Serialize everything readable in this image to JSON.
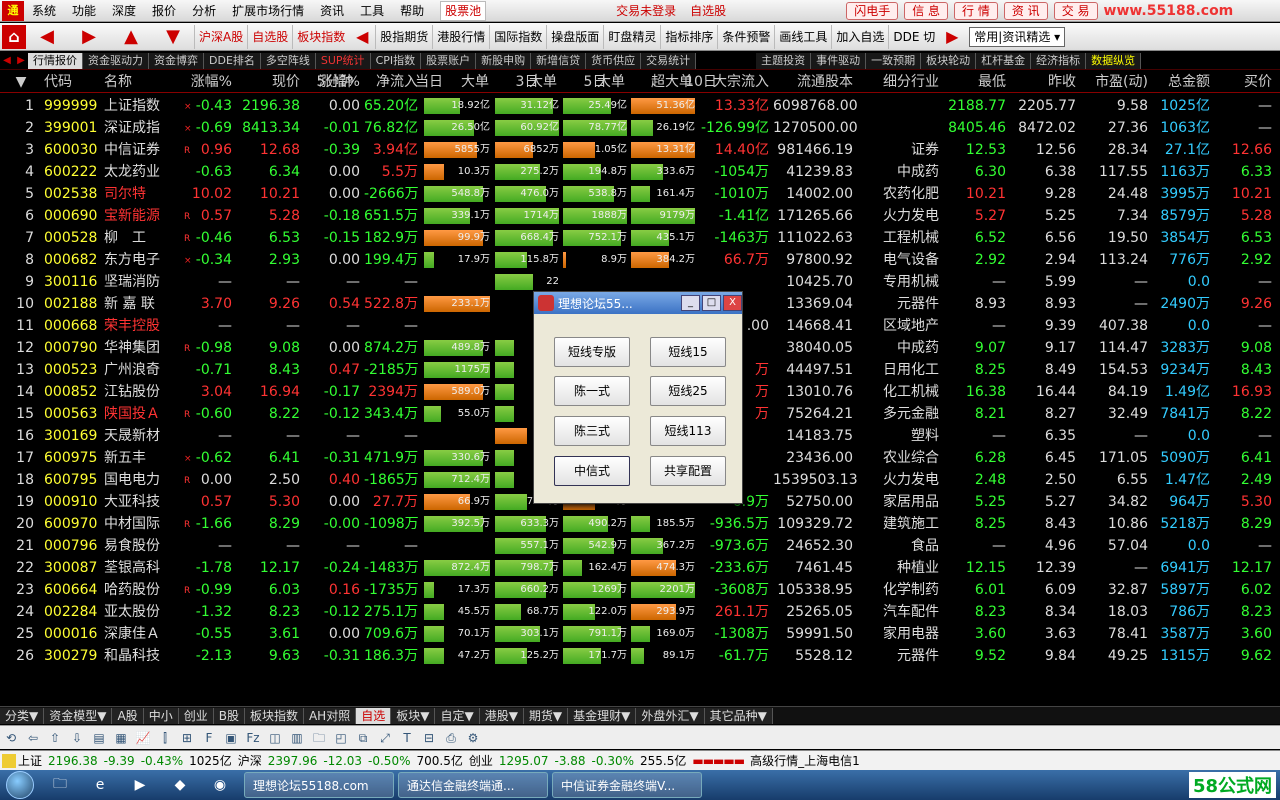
{
  "menubar": {
    "items": [
      "系统",
      "功能",
      "深度",
      "报价",
      "分析",
      "扩展市场行情",
      "资讯",
      "工具",
      "帮助"
    ],
    "stock_pool": "股票池",
    "login": "交易未登录",
    "favorite": "自选股",
    "right_buttons": [
      "闪电手",
      "信 息",
      "行 情",
      "资 讯",
      "交 易"
    ],
    "watermark": "www.55188.com"
  },
  "toolbar": {
    "buttons": [
      "沪深A股",
      "自选股",
      "板块指数",
      "股指期货",
      "港股行情",
      "国际指数",
      "操盘版面",
      "盯盘精灵",
      "指标排序",
      "条件预警",
      "画线工具",
      "加入自选",
      "DDE 切"
    ],
    "select_value": "常用|资讯精选"
  },
  "tabs": [
    "行情报价",
    "资金驱动力",
    "资金博弈",
    "DDE排名",
    "多空阵线",
    "SUP统计",
    "CPI指数",
    "股票账户",
    "新股申购",
    "新增信贷",
    "货币供应",
    "交易统计",
    "主题投资",
    "事件驱动",
    "一致预期",
    "板块轮动",
    "杠杆基金",
    "经济指标",
    "数据纵览"
  ],
  "header": {
    "groups": {
      "g5": "5分钟",
      "gd": "当日",
      "g3": "3日",
      "g5d": "5日",
      "g10": "10日"
    },
    "cols": [
      "代码",
      "名称",
      "涨幅%",
      "现价",
      "涨幅%",
      "净流入",
      "大单",
      "大单",
      "大单",
      "超大单",
      "大宗流入",
      "流通股本",
      "细分行业",
      "最低",
      "昨收",
      "市盈(动)",
      "总金额",
      "买价"
    ]
  },
  "rows": [
    {
      "n": "1",
      "code": "999999",
      "name": "上证指数",
      "nc": "W",
      "mark": "×",
      "chg": "-0.43",
      "chgc": "G",
      "price": "2196.38",
      "pc": "G",
      "m5": "0.00",
      "m5c": "W",
      "inflow": "65.20亿",
      "ic": "G",
      "d": "18.92亿",
      "dv": -0.55,
      "d3": "31.12亿",
      "d3v": -0.9,
      "d5": "25.49亿",
      "d5v": -0.75,
      "d10": "51.36亿",
      "d10v": 1.0,
      "bulk": "13.33亿",
      "bc": "R",
      "float": "6098768.00",
      "ind": "",
      "low": "2188.77",
      "lc": "G",
      "prev": "2205.77",
      "pe": "9.58",
      "amt": "1025亿",
      "bid": "—",
      "bidc": "W"
    },
    {
      "n": "2",
      "code": "399001",
      "name": "深证成指",
      "nc": "W",
      "mark": "×",
      "chg": "-0.69",
      "chgc": "G",
      "price": "8413.34",
      "pc": "G",
      "m5": "-0.01",
      "m5c": "G",
      "inflow": "76.82亿",
      "ic": "G",
      "d": "26.50亿",
      "dv": -0.75,
      "d3": "60.92亿",
      "d3v": -1.0,
      "d5": "78.77亿",
      "d5v": -1.0,
      "d10": "26.19亿",
      "d10v": -0.35,
      "bulk": "-126.99亿",
      "bc": "G",
      "float": "1270500.00",
      "ind": "",
      "low": "8405.46",
      "lc": "G",
      "prev": "8472.02",
      "pe": "27.36",
      "amt": "1063亿",
      "bid": "—",
      "bidc": "W"
    },
    {
      "n": "3",
      "code": "600030",
      "name": "中信证券",
      "nc": "W",
      "mark": "R",
      "chg": "0.96",
      "chgc": "R",
      "price": "12.68",
      "pc": "R",
      "m5": "-0.39",
      "m5c": "G",
      "inflow": "3.94亿",
      "ic": "R",
      "d": "5855万",
      "dv": 0.8,
      "d3": "6852万",
      "d3v": 0.6,
      "d5": "1.05亿",
      "d5v": 0.5,
      "d10": "13.31亿",
      "d10v": 1.0,
      "bulk": "14.40亿",
      "bc": "R",
      "float": "981466.19",
      "ind": "证券",
      "low": "12.53",
      "lc": "G",
      "prev": "12.56",
      "pe": "28.34",
      "amt": "27.1亿",
      "bid": "12.66",
      "bidc": "R"
    },
    {
      "n": "4",
      "code": "600222",
      "name": "太龙药业",
      "nc": "W",
      "mark": "",
      "chg": "-0.63",
      "chgc": "G",
      "price": "6.34",
      "pc": "G",
      "m5": "0.00",
      "m5c": "W",
      "inflow": "5.5万",
      "ic": "R",
      "d": "10.3万",
      "dv": 0.3,
      "d3": "275.2万",
      "d3v": -0.7,
      "d5": "194.8万",
      "d5v": -0.6,
      "d10": "333.6万",
      "d10v": -0.5,
      "bulk": "-1054万",
      "bc": "G",
      "float": "41239.83",
      "ind": "中成药",
      "low": "6.30",
      "lc": "G",
      "prev": "6.38",
      "pe": "117.55",
      "amt": "1163万",
      "bid": "6.33",
      "bidc": "G"
    },
    {
      "n": "5",
      "code": "002538",
      "name": "司尔特",
      "nc": "R",
      "mark": "",
      "chg": "10.02",
      "chgc": "R",
      "price": "10.21",
      "pc": "R",
      "m5": "0.00",
      "m5c": "W",
      "inflow": "-2666万",
      "ic": "G",
      "d": "548.8万",
      "dv": -0.9,
      "d3": "476.0万",
      "d3v": -0.8,
      "d5": "538.8万",
      "d5v": -0.8,
      "d10": "161.4万",
      "d10v": -0.3,
      "bulk": "-1010万",
      "bc": "G",
      "float": "14002.00",
      "ind": "农药化肥",
      "low": "10.21",
      "lc": "R",
      "prev": "9.28",
      "pe": "24.48",
      "amt": "3995万",
      "bid": "10.21",
      "bidc": "R"
    },
    {
      "n": "6",
      "code": "000690",
      "name": "宝新能源",
      "nc": "R",
      "mark": "R",
      "chg": "0.57",
      "chgc": "R",
      "price": "5.28",
      "pc": "R",
      "m5": "-0.18",
      "m5c": "G",
      "inflow": "651.5万",
      "ic": "G",
      "d": "339.1万",
      "dv": -0.7,
      "d3": "1714万",
      "d3v": -1.0,
      "d5": "1888万",
      "d5v": -1.0,
      "d10": "9179万",
      "d10v": -1.0,
      "bulk": "-1.41亿",
      "bc": "G",
      "float": "171265.66",
      "ind": "火力发电",
      "low": "5.27",
      "lc": "R",
      "prev": "5.25",
      "pe": "7.34",
      "amt": "8579万",
      "bid": "5.28",
      "bidc": "R"
    },
    {
      "n": "7",
      "code": "000528",
      "name": "柳　工",
      "nc": "W",
      "mark": "R",
      "chg": "-0.46",
      "chgc": "G",
      "price": "6.53",
      "pc": "G",
      "m5": "-0.15",
      "m5c": "G",
      "inflow": "182.9万",
      "ic": "G",
      "d": "99.9万",
      "dv": 0.9,
      "d3": "668.4万",
      "d3v": -0.9,
      "d5": "752.1万",
      "d5v": -0.9,
      "d10": "435.1万",
      "d10v": -0.6,
      "bulk": "-1463万",
      "bc": "G",
      "float": "111022.63",
      "ind": "工程机械",
      "low": "6.52",
      "lc": "G",
      "prev": "6.56",
      "pe": "19.50",
      "amt": "3854万",
      "bid": "6.53",
      "bidc": "G"
    },
    {
      "n": "8",
      "code": "000682",
      "name": "东方电子",
      "nc": "W",
      "mark": "×",
      "chg": "-0.34",
      "chgc": "G",
      "price": "2.93",
      "pc": "G",
      "m5": "0.00",
      "m5c": "W",
      "inflow": "199.4万",
      "ic": "G",
      "d": "17.9万",
      "dv": -0.15,
      "d3": "115.8万",
      "d3v": -0.5,
      "d5": "8.9万",
      "d5v": 0.05,
      "d10": "384.2万",
      "d10v": 0.6,
      "bulk": "66.7万",
      "bc": "R",
      "float": "97800.92",
      "ind": "电气设备",
      "low": "2.92",
      "lc": "G",
      "prev": "2.94",
      "pe": "113.24",
      "amt": "776万",
      "bid": "2.92",
      "bidc": "G"
    },
    {
      "n": "9",
      "code": "300116",
      "name": "坚瑞消防",
      "nc": "W",
      "mark": "",
      "chg": "—",
      "chgc": "W",
      "price": "—",
      "pc": "W",
      "m5": "—",
      "m5c": "W",
      "inflow": "—",
      "ic": "W",
      "d": "",
      "dv": 0,
      "d3": "22",
      "d3v": -0.6,
      "d5": "",
      "d5v": 0,
      "d10": "",
      "d10v": 0,
      "bulk": "",
      "bc": "W",
      "float": "10425.70",
      "ind": "专用机械",
      "low": "—",
      "lc": "W",
      "prev": "5.99",
      "pe": "—",
      "amt": "0.0",
      "bid": "—",
      "bidc": "W"
    },
    {
      "n": "10",
      "code": "002188",
      "name": "新 嘉 联",
      "nc": "W",
      "mark": "",
      "chg": "3.70",
      "chgc": "R",
      "price": "9.26",
      "pc": "R",
      "m5": "0.54",
      "m5c": "R",
      "inflow": "522.8万",
      "ic": "R",
      "d": "233.1万",
      "dv": 1.0,
      "d3": "",
      "d3v": 0,
      "d5": "",
      "d5v": 0,
      "d10": "",
      "d10v": 0,
      "bulk": "",
      "bc": "W",
      "float": "13369.04",
      "ind": "元器件",
      "low": "8.93",
      "lc": "W",
      "prev": "8.93",
      "pe": "—",
      "amt": "2490万",
      "bid": "9.26",
      "bidc": "R"
    },
    {
      "n": "11",
      "code": "000668",
      "name": "荣丰控股",
      "nc": "R",
      "mark": "",
      "chg": "—",
      "chgc": "W",
      "price": "—",
      "pc": "W",
      "m5": "—",
      "m5c": "W",
      "inflow": "—",
      "ic": "W",
      "d": "",
      "dv": 0,
      "d3": "",
      "d3v": 0,
      "d5": "",
      "d5v": 0,
      "d10": "",
      "d10v": 0,
      "bulk": ".00",
      "bc": "W",
      "float": "14668.41",
      "ind": "区域地产",
      "low": "—",
      "lc": "W",
      "prev": "9.39",
      "pe": "407.38",
      "amt": "0.0",
      "bid": "—",
      "bidc": "W"
    },
    {
      "n": "12",
      "code": "000790",
      "name": "华神集团",
      "nc": "W",
      "mark": "R",
      "chg": "-0.98",
      "chgc": "G",
      "price": "9.08",
      "pc": "G",
      "m5": "0.00",
      "m5c": "W",
      "inflow": "874.2万",
      "ic": "G",
      "d": "489.8万",
      "dv": -0.9,
      "d3": "1",
      "d3v": -0.3,
      "d5": "",
      "d5v": 0,
      "d10": "",
      "d10v": 0,
      "bulk": "",
      "bc": "W",
      "float": "38040.05",
      "ind": "中成药",
      "low": "9.07",
      "lc": "G",
      "prev": "9.17",
      "pe": "114.47",
      "amt": "3283万",
      "bid": "9.08",
      "bidc": "G"
    },
    {
      "n": "13",
      "code": "000523",
      "name": "广州浪奇",
      "nc": "W",
      "mark": "",
      "chg": "-0.71",
      "chgc": "G",
      "price": "8.43",
      "pc": "G",
      "m5": "0.47",
      "m5c": "R",
      "inflow": "-2185万",
      "ic": "G",
      "d": "1175万",
      "dv": -1.0,
      "d3": "",
      "d3v": -0.3,
      "d5": "",
      "d5v": 0,
      "d10": "",
      "d10v": 0,
      "bulk": "万",
      "bc": "R",
      "float": "44497.51",
      "ind": "日用化工",
      "low": "8.25",
      "lc": "G",
      "prev": "8.49",
      "pe": "154.53",
      "amt": "9234万",
      "bid": "8.43",
      "bidc": "G"
    },
    {
      "n": "14",
      "code": "000852",
      "name": "江钻股份",
      "nc": "W",
      "mark": "",
      "chg": "3.04",
      "chgc": "R",
      "price": "16.94",
      "pc": "R",
      "m5": "-0.17",
      "m5c": "G",
      "inflow": "2394万",
      "ic": "R",
      "d": "589.0万",
      "dv": 0.9,
      "d3": "",
      "d3v": -0.3,
      "d5": "",
      "d5v": 0,
      "d10": "",
      "d10v": 0,
      "bulk": "万",
      "bc": "R",
      "float": "13010.76",
      "ind": "化工机械",
      "low": "16.38",
      "lc": "G",
      "prev": "16.44",
      "pe": "84.19",
      "amt": "1.49亿",
      "bid": "16.93",
      "bidc": "R"
    },
    {
      "n": "15",
      "code": "000563",
      "name": "陕国投Ａ",
      "nc": "R",
      "mark": "R",
      "chg": "-0.60",
      "chgc": "G",
      "price": "8.22",
      "pc": "G",
      "m5": "-0.12",
      "m5c": "G",
      "inflow": "343.4万",
      "ic": "G",
      "d": "55.0万",
      "dv": -0.25,
      "d3": "",
      "d3v": -0.3,
      "d5": "",
      "d5v": 0,
      "d10": "",
      "d10v": 0,
      "bulk": "万",
      "bc": "R",
      "float": "75264.21",
      "ind": "多元金融",
      "low": "8.21",
      "lc": "G",
      "prev": "8.27",
      "pe": "32.49",
      "amt": "7841万",
      "bid": "8.22",
      "bidc": "G"
    },
    {
      "n": "16",
      "code": "300169",
      "name": "天晟新材",
      "nc": "W",
      "mark": "",
      "chg": "—",
      "chgc": "W",
      "price": "—",
      "pc": "W",
      "m5": "—",
      "m5c": "W",
      "inflow": "—",
      "ic": "W",
      "d": "",
      "dv": 0,
      "d3": "12",
      "d3v": 0.5,
      "d5": "",
      "d5v": 0,
      "d10": "",
      "d10v": 0,
      "bulk": "",
      "bc": "W",
      "float": "14183.75",
      "ind": "塑料",
      "low": "—",
      "lc": "W",
      "prev": "6.35",
      "pe": "—",
      "amt": "0.0",
      "bid": "—",
      "bidc": "W"
    },
    {
      "n": "17",
      "code": "600975",
      "name": "新五丰",
      "nc": "W",
      "mark": "×",
      "chg": "-0.62",
      "chgc": "G",
      "price": "6.41",
      "pc": "G",
      "m5": "-0.31",
      "m5c": "G",
      "inflow": "471.9万",
      "ic": "G",
      "d": "330.6万",
      "dv": -0.9,
      "d3": "14",
      "d3v": -0.3,
      "d5": "",
      "d5v": 0,
      "d10": "",
      "d10v": 0,
      "bulk": "",
      "bc": "W",
      "float": "23436.00",
      "ind": "农业综合",
      "low": "6.28",
      "lc": "G",
      "prev": "6.45",
      "pe": "171.05",
      "amt": "5090万",
      "bid": "6.41",
      "bidc": "G"
    },
    {
      "n": "18",
      "code": "600795",
      "name": "国电电力",
      "nc": "W",
      "mark": "R",
      "chg": "0.00",
      "chgc": "W",
      "price": "2.50",
      "pc": "W",
      "m5": "0.40",
      "m5c": "R",
      "inflow": "-1865万",
      "ic": "G",
      "d": "712.4万",
      "dv": -1.0,
      "d3": "76",
      "d3v": -0.3,
      "d5": "",
      "d5v": 0,
      "d10": "",
      "d10v": 0,
      "bulk": "",
      "bc": "W",
      "float": "1539503.13",
      "ind": "火力发电",
      "low": "2.48",
      "lc": "G",
      "prev": "2.50",
      "pe": "6.55",
      "amt": "1.47亿",
      "bid": "2.49",
      "bidc": "G"
    },
    {
      "n": "19",
      "code": "000910",
      "name": "大亚科技",
      "nc": "W",
      "mark": "",
      "chg": "0.57",
      "chgc": "R",
      "price": "5.30",
      "pc": "R",
      "m5": "0.00",
      "m5c": "W",
      "inflow": "27.7万",
      "ic": "R",
      "d": "66.9万",
      "dv": 0.7,
      "d3": "72.5万",
      "d3v": -0.5,
      "d5": "83.4万",
      "d5v": 0.5,
      "d10": "",
      "d10v": 0,
      "bulk": "-6.9万",
      "bc": "G",
      "float": "52750.00",
      "ind": "家居用品",
      "low": "5.25",
      "lc": "G",
      "prev": "5.27",
      "pe": "34.82",
      "amt": "964万",
      "bid": "5.30",
      "bidc": "R"
    },
    {
      "n": "20",
      "code": "600970",
      "name": "中材国际",
      "nc": "W",
      "mark": "R",
      "chg": "-1.66",
      "chgc": "G",
      "price": "8.29",
      "pc": "G",
      "m5": "-0.00",
      "m5c": "G",
      "inflow": "-1098万",
      "ic": "G",
      "d": "392.5万",
      "dv": -0.9,
      "d3": "633.3万",
      "d3v": -0.8,
      "d5": "490.2万",
      "d5v": -0.7,
      "d10": "185.5万",
      "d10v": -0.3,
      "bulk": "-936.5万",
      "bc": "G",
      "float": "109329.72",
      "ind": "建筑施工",
      "low": "8.25",
      "lc": "G",
      "prev": "8.43",
      "pe": "10.86",
      "amt": "5218万",
      "bid": "8.29",
      "bidc": "G"
    },
    {
      "n": "21",
      "code": "000796",
      "name": "易食股份",
      "nc": "W",
      "mark": "",
      "chg": "—",
      "chgc": "W",
      "price": "—",
      "pc": "W",
      "m5": "—",
      "m5c": "W",
      "inflow": "—",
      "ic": "W",
      "d": "",
      "dv": 0,
      "d3": "557.1万",
      "d3v": -0.8,
      "d5": "542.9万",
      "d5v": -0.8,
      "d10": "367.2万",
      "d10v": -0.5,
      "bulk": "-973.6万",
      "bc": "G",
      "float": "24652.30",
      "ind": "食品",
      "low": "—",
      "lc": "W",
      "prev": "4.96",
      "pe": "57.04",
      "amt": "0.0",
      "bid": "—",
      "bidc": "W"
    },
    {
      "n": "22",
      "code": "300087",
      "name": "荃银高科",
      "nc": "W",
      "mark": "",
      "chg": "-1.78",
      "chgc": "G",
      "price": "12.17",
      "pc": "G",
      "m5": "-0.24",
      "m5c": "G",
      "inflow": "-1483万",
      "ic": "G",
      "d": "872.4万",
      "dv": -1.0,
      "d3": "798.7万",
      "d3v": -0.9,
      "d5": "162.4万",
      "d5v": -0.3,
      "d10": "474.3万",
      "d10v": 0.7,
      "bulk": "-233.6万",
      "bc": "G",
      "float": "7461.45",
      "ind": "种植业",
      "low": "12.15",
      "lc": "G",
      "prev": "12.39",
      "pe": "—",
      "amt": "6941万",
      "bid": "12.17",
      "bidc": "G"
    },
    {
      "n": "23",
      "code": "600664",
      "name": "哈药股份",
      "nc": "W",
      "mark": "R",
      "chg": "-0.99",
      "chgc": "G",
      "price": "6.03",
      "pc": "G",
      "m5": "0.16",
      "m5c": "R",
      "inflow": "-1735万",
      "ic": "G",
      "d": "17.3万",
      "dv": -0.15,
      "d3": "660.2万",
      "d3v": -0.8,
      "d5": "1269万",
      "d5v": -0.9,
      "d10": "2201万",
      "d10v": -1.0,
      "bulk": "-3608万",
      "bc": "G",
      "float": "105338.95",
      "ind": "化学制药",
      "low": "6.01",
      "lc": "G",
      "prev": "6.09",
      "pe": "32.87",
      "amt": "5897万",
      "bid": "6.02",
      "bidc": "G"
    },
    {
      "n": "24",
      "code": "002284",
      "name": "亚太股份",
      "nc": "W",
      "mark": "",
      "chg": "-1.32",
      "chgc": "G",
      "price": "8.23",
      "pc": "G",
      "m5": "-0.12",
      "m5c": "G",
      "inflow": "275.1万",
      "ic": "G",
      "d": "45.5万",
      "dv": -0.3,
      "d3": "68.7万",
      "d3v": -0.4,
      "d5": "122.0万",
      "d5v": -0.5,
      "d10": "293.9万",
      "d10v": 0.7,
      "bulk": "261.1万",
      "bc": "R",
      "float": "25265.05",
      "ind": "汽车配件",
      "low": "8.23",
      "lc": "G",
      "prev": "8.34",
      "pe": "18.03",
      "amt": "786万",
      "bid": "8.23",
      "bidc": "G"
    },
    {
      "n": "25",
      "code": "000016",
      "name": "深康佳Ａ",
      "nc": "W",
      "mark": "",
      "chg": "-0.55",
      "chgc": "G",
      "price": "3.61",
      "pc": "G",
      "m5": "0.00",
      "m5c": "W",
      "inflow": "709.6万",
      "ic": "G",
      "d": "70.1万",
      "dv": -0.3,
      "d3": "303.1万",
      "d3v": -0.7,
      "d5": "791.1万",
      "d5v": -0.9,
      "d10": "169.0万",
      "d10v": -0.3,
      "bulk": "-1308万",
      "bc": "G",
      "float": "59991.50",
      "ind": "家用电器",
      "low": "3.60",
      "lc": "G",
      "prev": "3.63",
      "pe": "78.41",
      "amt": "3587万",
      "bid": "3.60",
      "bidc": "G"
    },
    {
      "n": "26",
      "code": "300279",
      "name": "和晶科技",
      "nc": "W",
      "mark": "",
      "chg": "-2.13",
      "chgc": "G",
      "price": "9.63",
      "pc": "G",
      "m5": "-0.31",
      "m5c": "G",
      "inflow": "186.3万",
      "ic": "G",
      "d": "47.2万",
      "dv": -0.3,
      "d3": "125.2万",
      "d3v": -0.5,
      "d5": "171.7万",
      "d5v": -0.6,
      "d10": "89.1万",
      "d10v": -0.2,
      "bulk": "-61.7万",
      "bc": "G",
      "float": "5528.12",
      "ind": "元器件",
      "low": "9.52",
      "lc": "G",
      "prev": "9.84",
      "pe": "49.25",
      "amt": "1315万",
      "bid": "9.62",
      "bidc": "G"
    }
  ],
  "bottom_tabs": [
    "分类▼",
    "资金模型▼",
    "A股",
    "中小",
    "创业",
    "B股",
    "板块指数",
    "AH对照",
    "自选",
    "板块▼",
    "自定▼",
    "港股▼",
    "期货▼",
    "基金理财▼",
    "外盘外汇▼",
    "其它品种▼"
  ],
  "status": {
    "sh_label": "上证",
    "sh_price": "2196.38",
    "sh_chg": "-9.39",
    "sh_pct": "-0.43%",
    "sh_amt": "1025亿",
    "hs_label": "沪深",
    "hs_price": "2397.96",
    "hs_chg": "-12.03",
    "hs_pct": "-0.50%",
    "hs_amt": "700.5亿",
    "cy_label": "创业",
    "cy_price": "1295.07",
    "cy_chg": "-3.88",
    "cy_pct": "-0.30%",
    "cy_amt": "255.5亿",
    "server": "高级行情_上海电信1"
  },
  "taskbar": {
    "windows": [
      "理想论坛55188.com",
      "通达信金融终端通...",
      "中信证券金融终端V..."
    ],
    "tray_watermark": "58公式网"
  },
  "dialog": {
    "title": "理想论坛55...",
    "buttons": [
      "短线专版",
      "短线15",
      "陈一式",
      "短线25",
      "陈三式",
      "短线113",
      "中信式",
      "共享配置"
    ]
  }
}
